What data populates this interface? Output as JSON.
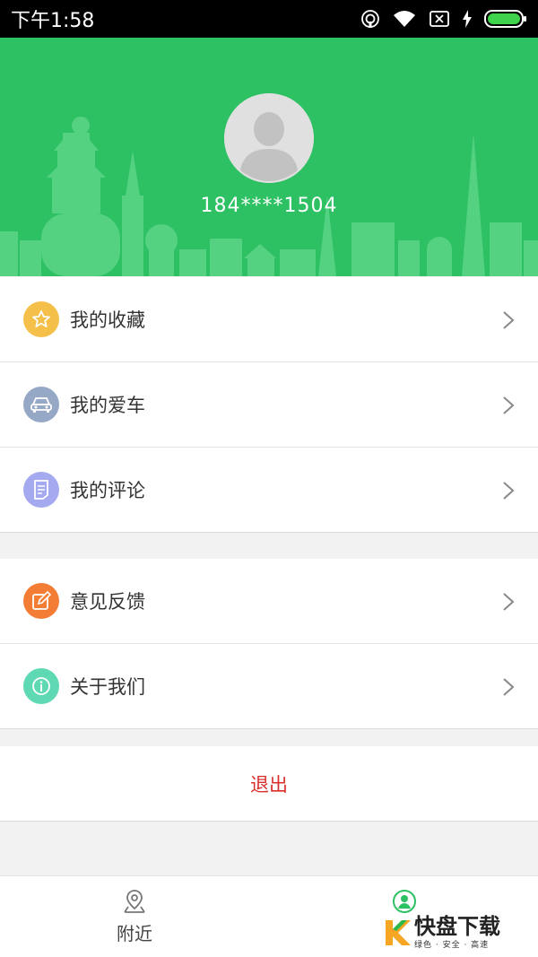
{
  "status_bar": {
    "time": "下午1:58",
    "icons": [
      "hotspot-icon",
      "wifi-icon",
      "no-sim-icon",
      "charging-icon",
      "battery-icon"
    ]
  },
  "profile": {
    "avatar_icon": "default-avatar-icon",
    "phone": "184****1504"
  },
  "menu_group_1": [
    {
      "label": "我的收藏",
      "icon": "star-icon",
      "color": "#f5c04a"
    },
    {
      "label": "我的爱车",
      "icon": "car-icon",
      "color": "#95a8c6"
    },
    {
      "label": "我的评论",
      "icon": "comment-icon",
      "color": "#a5a9ef"
    }
  ],
  "menu_group_2": [
    {
      "label": "意见反馈",
      "icon": "edit-icon",
      "color": "#f47d36"
    },
    {
      "label": "关于我们",
      "icon": "info-icon",
      "color": "#5fd9b4"
    }
  ],
  "logout_label": "退出",
  "tabbar": {
    "nearby_label": "附近",
    "mine_icon": "user-icon"
  },
  "watermark": {
    "main": "快盘下载",
    "sub": "绿色 · 安全 · 高速"
  },
  "colors": {
    "brand_green": "#2dc163",
    "logout_red": "#d9302c"
  }
}
